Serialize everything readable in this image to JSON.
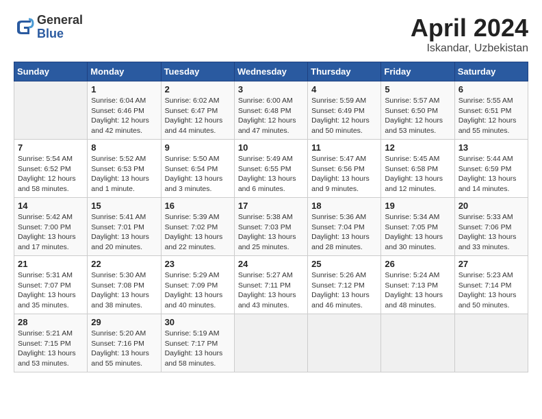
{
  "header": {
    "logo_general": "General",
    "logo_blue": "Blue",
    "month_title": "April 2024",
    "location": "Iskandar, Uzbekistan"
  },
  "days_of_week": [
    "Sunday",
    "Monday",
    "Tuesday",
    "Wednesday",
    "Thursday",
    "Friday",
    "Saturday"
  ],
  "weeks": [
    [
      {
        "day": "",
        "info": ""
      },
      {
        "day": "1",
        "info": "Sunrise: 6:04 AM\nSunset: 6:46 PM\nDaylight: 12 hours\nand 42 minutes."
      },
      {
        "day": "2",
        "info": "Sunrise: 6:02 AM\nSunset: 6:47 PM\nDaylight: 12 hours\nand 44 minutes."
      },
      {
        "day": "3",
        "info": "Sunrise: 6:00 AM\nSunset: 6:48 PM\nDaylight: 12 hours\nand 47 minutes."
      },
      {
        "day": "4",
        "info": "Sunrise: 5:59 AM\nSunset: 6:49 PM\nDaylight: 12 hours\nand 50 minutes."
      },
      {
        "day": "5",
        "info": "Sunrise: 5:57 AM\nSunset: 6:50 PM\nDaylight: 12 hours\nand 53 minutes."
      },
      {
        "day": "6",
        "info": "Sunrise: 5:55 AM\nSunset: 6:51 PM\nDaylight: 12 hours\nand 55 minutes."
      }
    ],
    [
      {
        "day": "7",
        "info": "Sunrise: 5:54 AM\nSunset: 6:52 PM\nDaylight: 12 hours\nand 58 minutes."
      },
      {
        "day": "8",
        "info": "Sunrise: 5:52 AM\nSunset: 6:53 PM\nDaylight: 13 hours\nand 1 minute."
      },
      {
        "day": "9",
        "info": "Sunrise: 5:50 AM\nSunset: 6:54 PM\nDaylight: 13 hours\nand 3 minutes."
      },
      {
        "day": "10",
        "info": "Sunrise: 5:49 AM\nSunset: 6:55 PM\nDaylight: 13 hours\nand 6 minutes."
      },
      {
        "day": "11",
        "info": "Sunrise: 5:47 AM\nSunset: 6:56 PM\nDaylight: 13 hours\nand 9 minutes."
      },
      {
        "day": "12",
        "info": "Sunrise: 5:45 AM\nSunset: 6:58 PM\nDaylight: 13 hours\nand 12 minutes."
      },
      {
        "day": "13",
        "info": "Sunrise: 5:44 AM\nSunset: 6:59 PM\nDaylight: 13 hours\nand 14 minutes."
      }
    ],
    [
      {
        "day": "14",
        "info": "Sunrise: 5:42 AM\nSunset: 7:00 PM\nDaylight: 13 hours\nand 17 minutes."
      },
      {
        "day": "15",
        "info": "Sunrise: 5:41 AM\nSunset: 7:01 PM\nDaylight: 13 hours\nand 20 minutes."
      },
      {
        "day": "16",
        "info": "Sunrise: 5:39 AM\nSunset: 7:02 PM\nDaylight: 13 hours\nand 22 minutes."
      },
      {
        "day": "17",
        "info": "Sunrise: 5:38 AM\nSunset: 7:03 PM\nDaylight: 13 hours\nand 25 minutes."
      },
      {
        "day": "18",
        "info": "Sunrise: 5:36 AM\nSunset: 7:04 PM\nDaylight: 13 hours\nand 28 minutes."
      },
      {
        "day": "19",
        "info": "Sunrise: 5:34 AM\nSunset: 7:05 PM\nDaylight: 13 hours\nand 30 minutes."
      },
      {
        "day": "20",
        "info": "Sunrise: 5:33 AM\nSunset: 7:06 PM\nDaylight: 13 hours\nand 33 minutes."
      }
    ],
    [
      {
        "day": "21",
        "info": "Sunrise: 5:31 AM\nSunset: 7:07 PM\nDaylight: 13 hours\nand 35 minutes."
      },
      {
        "day": "22",
        "info": "Sunrise: 5:30 AM\nSunset: 7:08 PM\nDaylight: 13 hours\nand 38 minutes."
      },
      {
        "day": "23",
        "info": "Sunrise: 5:29 AM\nSunset: 7:09 PM\nDaylight: 13 hours\nand 40 minutes."
      },
      {
        "day": "24",
        "info": "Sunrise: 5:27 AM\nSunset: 7:11 PM\nDaylight: 13 hours\nand 43 minutes."
      },
      {
        "day": "25",
        "info": "Sunrise: 5:26 AM\nSunset: 7:12 PM\nDaylight: 13 hours\nand 46 minutes."
      },
      {
        "day": "26",
        "info": "Sunrise: 5:24 AM\nSunset: 7:13 PM\nDaylight: 13 hours\nand 48 minutes."
      },
      {
        "day": "27",
        "info": "Sunrise: 5:23 AM\nSunset: 7:14 PM\nDaylight: 13 hours\nand 50 minutes."
      }
    ],
    [
      {
        "day": "28",
        "info": "Sunrise: 5:21 AM\nSunset: 7:15 PM\nDaylight: 13 hours\nand 53 minutes."
      },
      {
        "day": "29",
        "info": "Sunrise: 5:20 AM\nSunset: 7:16 PM\nDaylight: 13 hours\nand 55 minutes."
      },
      {
        "day": "30",
        "info": "Sunrise: 5:19 AM\nSunset: 7:17 PM\nDaylight: 13 hours\nand 58 minutes."
      },
      {
        "day": "",
        "info": ""
      },
      {
        "day": "",
        "info": ""
      },
      {
        "day": "",
        "info": ""
      },
      {
        "day": "",
        "info": ""
      }
    ]
  ]
}
